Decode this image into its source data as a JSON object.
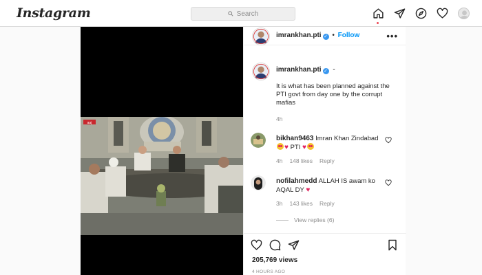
{
  "topbar": {
    "logo": "Instagram",
    "search_placeholder": "Search"
  },
  "post": {
    "author": "imrankhan.pti",
    "follow_label": "Follow",
    "header_separator": "•",
    "caption_suffix": "-",
    "caption": "It is what has been planned against the PTI govt from day one by the corrupt mafias",
    "caption_time": "4h",
    "views": "205,769 views",
    "posted_ago": "4 HOURS AGO"
  },
  "comments": [
    {
      "username": "bikhan9463",
      "text": "Imran Khan Zindabad",
      "text2": "PTI",
      "time": "4h",
      "likes": "148 likes",
      "reply_label": "Reply"
    },
    {
      "username": "nofilahmedd",
      "text": "ALLAH IS awam ko AQAL DY",
      "time": "3h",
      "likes": "143 likes",
      "reply_label": "Reply"
    }
  ],
  "view_replies": "View replies (6)",
  "video_overlay": "aaj",
  "colors": {
    "accent": "#0095f6",
    "verified": "#3897f0",
    "notification_dot": "#ed4956",
    "border": "#dbdbdb"
  },
  "icons": [
    "search-icon",
    "home-icon",
    "direct-icon",
    "explore-icon",
    "heart-icon",
    "profile-avatar",
    "more-icon",
    "like-icon",
    "comment-icon",
    "share-icon",
    "bookmark-icon"
  ]
}
